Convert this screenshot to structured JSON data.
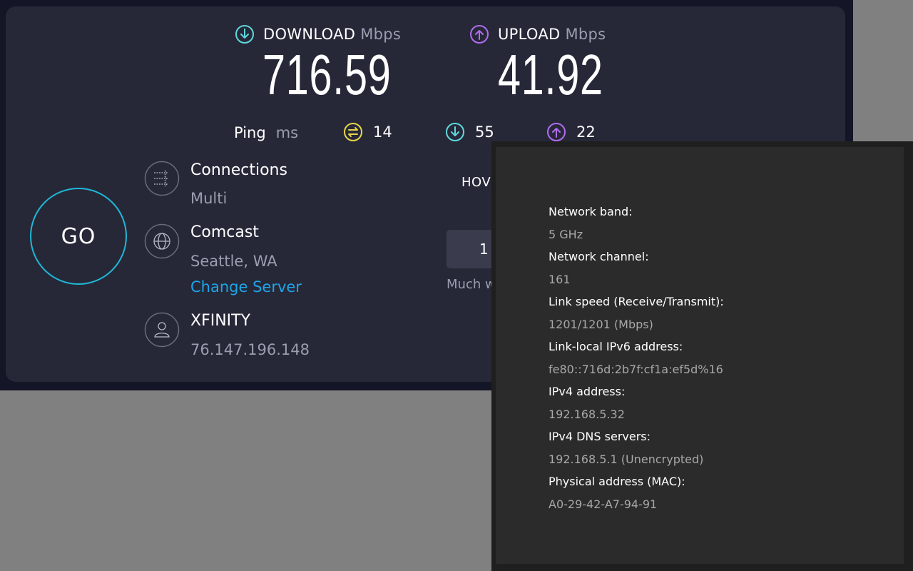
{
  "speedtest": {
    "download": {
      "label": "DOWNLOAD",
      "unit": "Mbps",
      "value": "716.59"
    },
    "upload": {
      "label": "UPLOAD",
      "unit": "Mbps",
      "value": "41.92"
    },
    "ping": {
      "label": "Ping",
      "unit": "ms",
      "idle": "14",
      "download": "55",
      "upload": "22"
    },
    "go_label": "GO",
    "connections": {
      "title": "Connections",
      "value": "Multi"
    },
    "isp": {
      "title": "Comcast",
      "location": "Seattle, WA",
      "change_server": "Change Server"
    },
    "host": {
      "title": "XFINITY",
      "ip": "76.147.196.148"
    },
    "survey": {
      "question": "HOV",
      "rating": "1",
      "hint": "Much w"
    },
    "colors": {
      "download": "#5fd8dc",
      "upload": "#b26cf0",
      "idle": "#e8d44a",
      "go_ring": "#1fb8d6",
      "link": "#1ea5e8"
    }
  },
  "network_properties": {
    "items": [
      {
        "label": "Network band:",
        "value": "5 GHz"
      },
      {
        "label": "Network channel:",
        "value": "161"
      },
      {
        "label": "Link speed (Receive/Transmit):",
        "value": "1201/1201 (Mbps)"
      },
      {
        "label": "Link-local IPv6 address:",
        "value": "fe80::716d:2b7f:cf1a:ef5d%16"
      },
      {
        "label": "IPv4 address:",
        "value": "192.168.5.32"
      },
      {
        "label": "IPv4 DNS servers:",
        "value": "192.168.5.1 (Unencrypted)"
      },
      {
        "label": "Physical address (MAC):",
        "value": "A0-29-42-A7-94-91"
      }
    ]
  }
}
